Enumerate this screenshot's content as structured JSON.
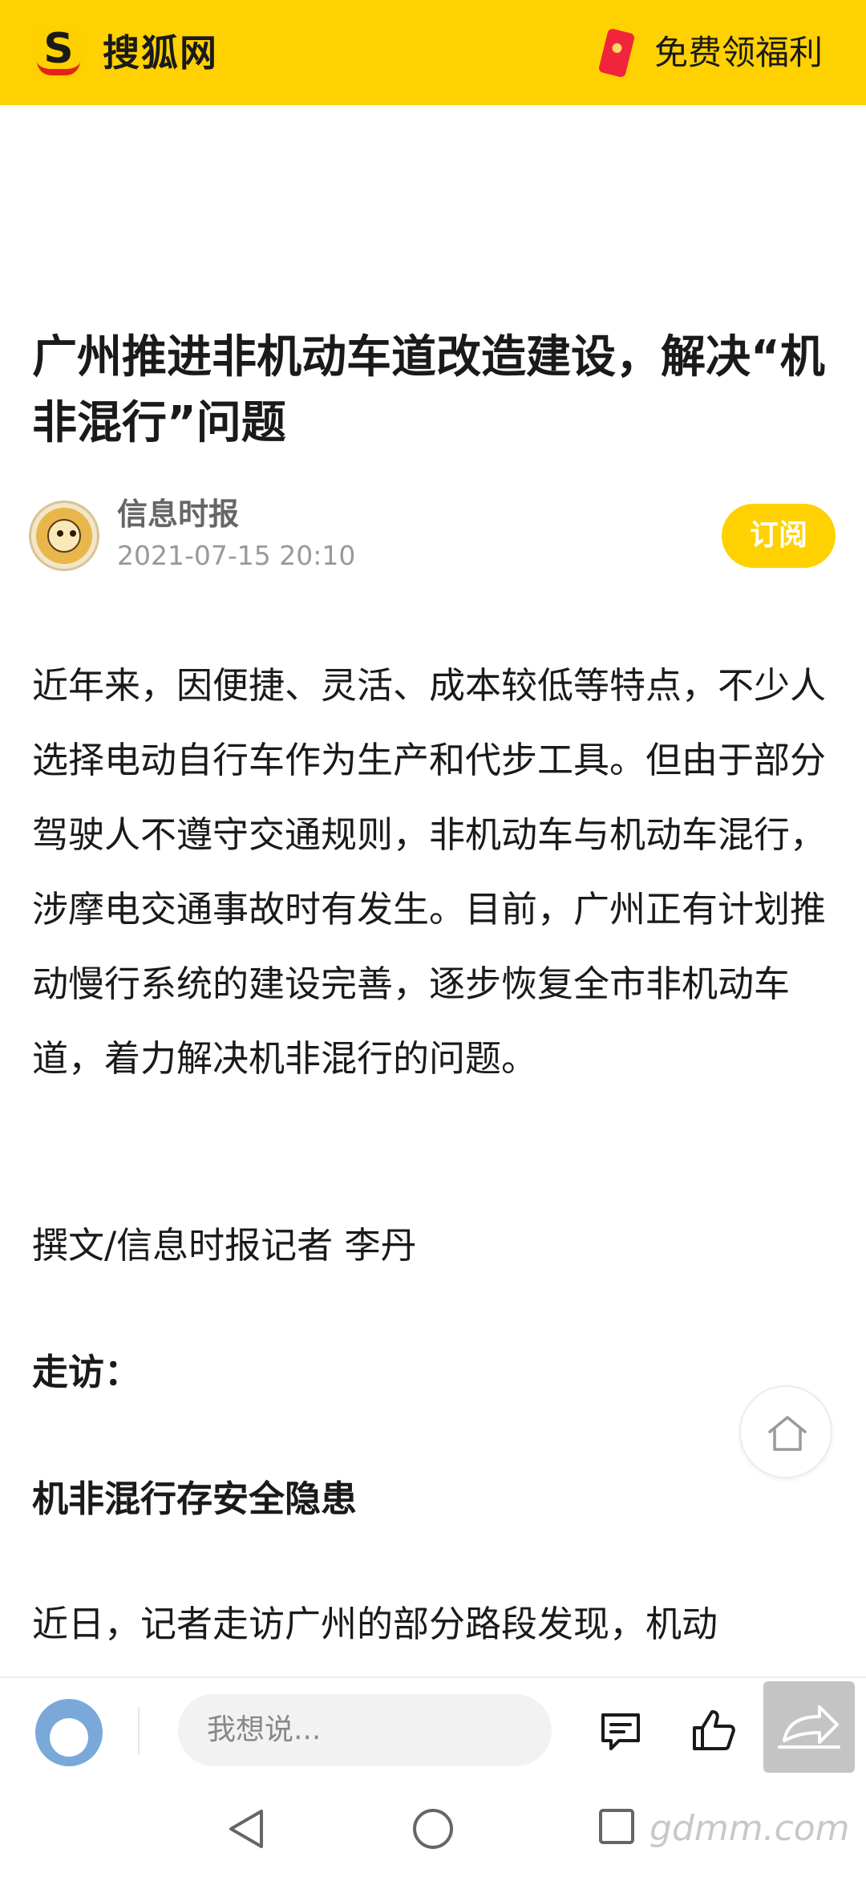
{
  "header": {
    "brand": "搜狐网",
    "welfare_label": "免费领福利",
    "logo_icon": "sohu-logo-icon",
    "redpacket_icon": "red-packet-icon",
    "bg_color": "#FFD100"
  },
  "article": {
    "title": "广州推进非机动车道改造建设，解决“机非混行”问题",
    "source": "信息时报",
    "publish_time": "2021-07-15 20:10",
    "subscribe_label": "订阅",
    "paragraphs": [
      "近年来，因便捷、灵活、成本较低等特点，不少人选择电动自行车作为生产和代步工具。但由于部分驾驶人不遵守交通规则，非机动车与机动车混行，涉摩电交通事故时有发生。目前，广州正有计划推动慢行系统的建设完善，逐步恢复全市非机动车道，着力解决机非混行的问题。",
      "撰文/信息时报记者 李丹",
      "走访：",
      "机非混行存安全隐患",
      "近日，记者走访广州的部分路段发现，机动"
    ]
  },
  "bottom_bar": {
    "comment_placeholder": "我想说...",
    "icons": [
      "user-avatar-icon",
      "comment-list-icon",
      "thumbs-up-icon",
      "share-icon"
    ]
  },
  "system_nav": {
    "icons": [
      "back-icon",
      "home-circle-icon",
      "recents-icon"
    ]
  },
  "watermark": "gdmm.com"
}
